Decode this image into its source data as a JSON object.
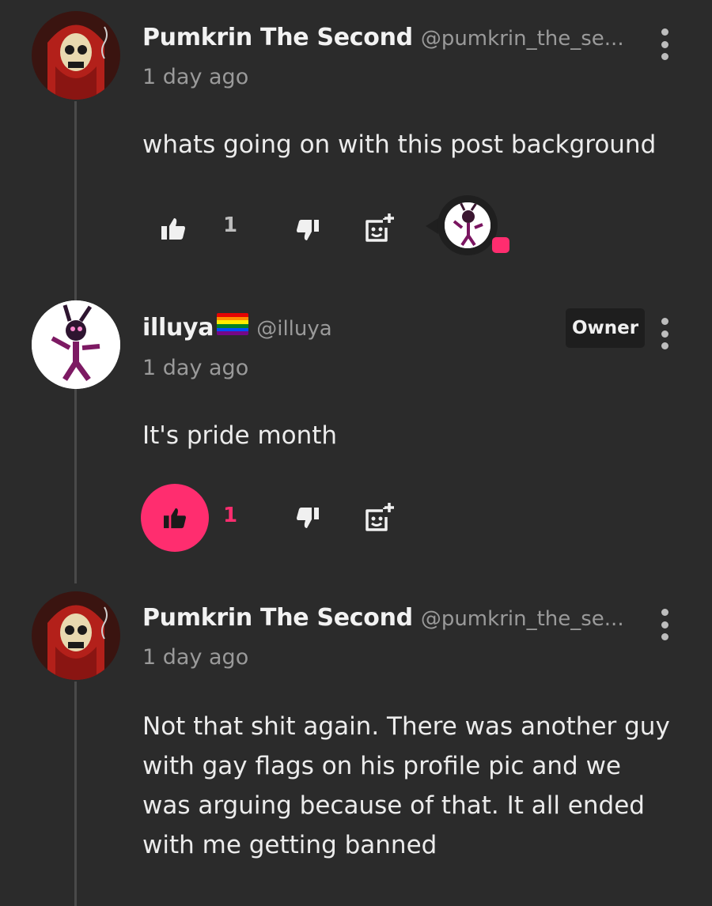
{
  "comments": [
    {
      "name": "Pumkrin The Second",
      "handle": "@pumkrin_the_se...",
      "time": "1 day ago",
      "text": "whats going on with this post background",
      "likes": "1",
      "avatar": "skull-hood-avatar"
    },
    {
      "name": "illuya",
      "handle": "@illuya",
      "time": "1 day ago",
      "text": "It's pride month",
      "likes": "1",
      "badge": "Owner",
      "avatar": "bunny-animatronic-avatar",
      "liked": true
    },
    {
      "name": "Pumkrin The Second",
      "handle": "@pumkrin_the_se...",
      "time": "1 day ago",
      "text_lines": [
        "Not that shit again. There was another guy",
        "with gay flags on his profile pic and we",
        "was arguing because of that. It all ended",
        "with me getting banned"
      ],
      "avatar": "skull-hood-avatar"
    }
  ],
  "colors": {
    "background": "#2b2b2b",
    "accent": "#ff2d6f",
    "muted": "#9a9a9a"
  },
  "icons": [
    "thumbs-up-icon",
    "thumbs-down-icon",
    "add-reaction-icon",
    "more-vertical-icon"
  ]
}
